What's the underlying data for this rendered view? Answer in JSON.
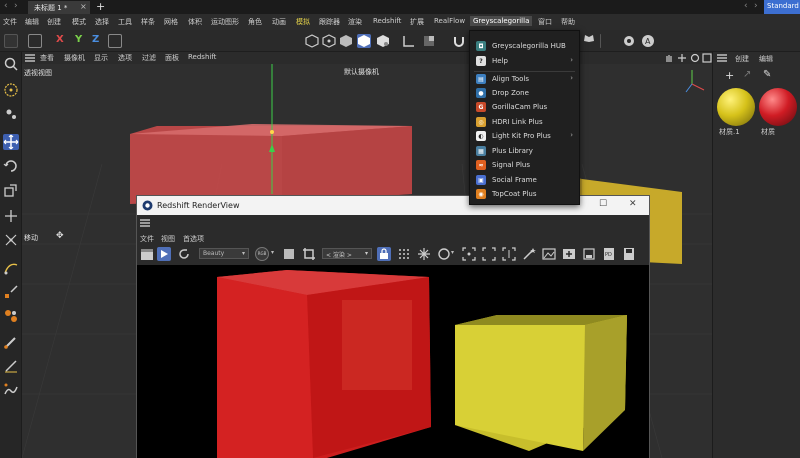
{
  "tabs": {
    "active_label": "未标题 1 *",
    "close_glyph": "×",
    "new_tab_glyph": "+",
    "layout_label": "Standard"
  },
  "menu": [
    "文件",
    "编辑",
    "创建",
    "模式",
    "选择",
    "工具",
    "样条",
    "网格",
    "体积",
    "运动图形",
    "角色",
    "动画",
    "模拟",
    "跟踪器",
    "渲染",
    "Redshift",
    "扩展",
    "RealFlow",
    "Greyscalegorilla",
    "窗口",
    "帮助"
  ],
  "toolbar": {
    "axis_x": "X",
    "axis_y": "Y",
    "axis_z": "Z",
    "colors": {
      "x": "#e04a4a",
      "y": "#7ad04a",
      "z": "#4a8ee0"
    }
  },
  "viewport": {
    "menus": [
      "查看",
      "摄像机",
      "显示",
      "选项",
      "过滤",
      "面板",
      "Redshift"
    ],
    "view_label": "透视视图",
    "camera_label": "默认摄像机",
    "move_label": "移动"
  },
  "right_panel": {
    "menus": [
      "创建",
      "编辑"
    ],
    "materials": [
      {
        "name": "材质.1",
        "color": "#d6c21a"
      },
      {
        "name": "材质",
        "color": "#d01c24"
      }
    ]
  },
  "dropdown": {
    "items": [
      {
        "label": "Greyscalegorilla HUB",
        "icon": "hub-icon",
        "color": "#3b7f80",
        "submenu": false
      },
      {
        "label": "Help",
        "icon": "help-icon",
        "color": "#e0e0e0",
        "submenu": true
      },
      {
        "label": "Align Tools",
        "icon": "align-icon",
        "color": "#3d7fbf",
        "submenu": true
      },
      {
        "label": "Drop Zone",
        "icon": "dropzone-icon",
        "color": "#2f6fa8",
        "submenu": false
      },
      {
        "label": "GorillaCam Plus",
        "icon": "gorillacam-icon",
        "color": "#c84a2a",
        "submenu": false
      },
      {
        "label": "HDRI Link Plus",
        "icon": "hdri-icon",
        "color": "#d9a030",
        "submenu": false
      },
      {
        "label": "Light Kit Pro Plus",
        "icon": "lightkit-icon",
        "color": "#f0f0f0",
        "submenu": true
      },
      {
        "label": "Plus Library",
        "icon": "library-icon",
        "color": "#4a7fa0",
        "submenu": false
      },
      {
        "label": "Signal Plus",
        "icon": "signal-icon",
        "color": "#e06020",
        "submenu": false
      },
      {
        "label": "Social Frame",
        "icon": "socialframe-icon",
        "color": "#4a6fd0",
        "submenu": false
      },
      {
        "label": "TopCoat Plus",
        "icon": "topcoat-icon",
        "color": "#e08020",
        "submenu": false
      }
    ]
  },
  "renderview": {
    "title": "Redshift RenderView",
    "menus": [
      "文件",
      "视图",
      "首选项"
    ],
    "aov_value": "Beauty",
    "mode_value": "RGB",
    "render_value": "< 渲染 >"
  }
}
